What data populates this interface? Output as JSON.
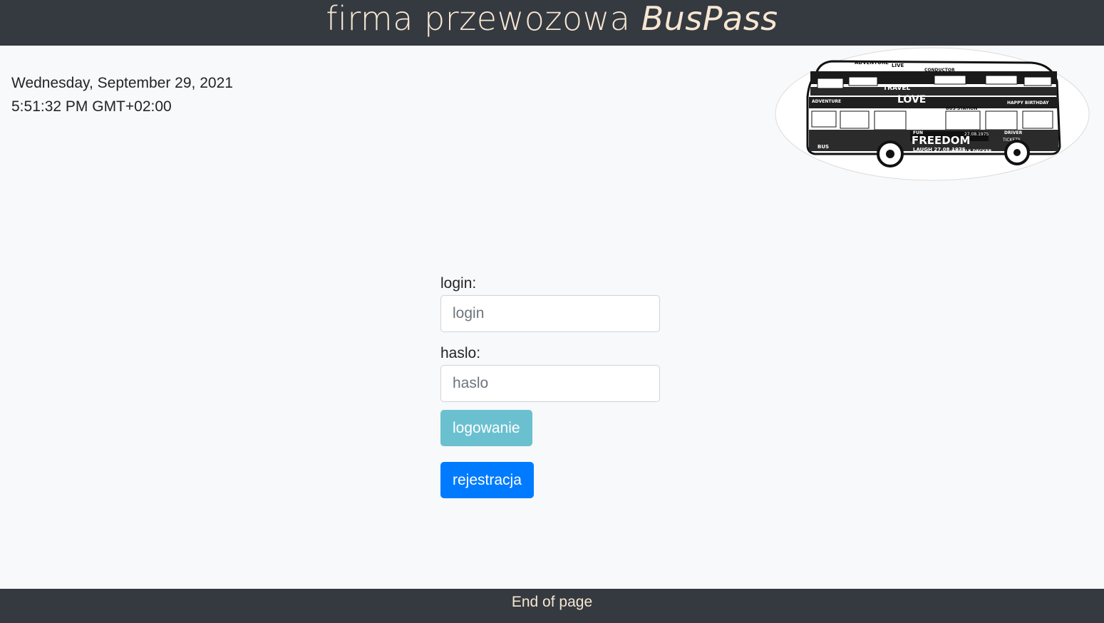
{
  "header": {
    "title_prefix": "firma przewozowa ",
    "title_brand": "BusPass"
  },
  "datetime": {
    "date": "Wednesday, September 29, 2021",
    "time": "5:51:32 PM GMT+02:00"
  },
  "logo": {
    "icon": "bus-word-cloud-logo",
    "words": [
      "ADVENTURE",
      "LIVE",
      "LAUGH",
      "CONDUCTOR",
      "TRAVEL",
      "LOVE",
      "HAPPY BIRTHDAY",
      "BUS STATION",
      "FREEDOM",
      "DRIVER",
      "DOUBLE DECKER",
      "TICKETS",
      "FUN",
      "BUS",
      "27.08.1975"
    ]
  },
  "form": {
    "login_label": "login:",
    "login_placeholder": "login",
    "password_label": "haslo:",
    "password_placeholder": "haslo",
    "login_button": "logowanie",
    "register_button": "rejestracja"
  },
  "footer": {
    "text": "End of page"
  },
  "colors": {
    "header_bg": "#343a40",
    "header_text": "#f8e6d2",
    "page_bg": "#f8f9fa",
    "login_button": "#6bc0d0",
    "register_button": "#007bff"
  }
}
